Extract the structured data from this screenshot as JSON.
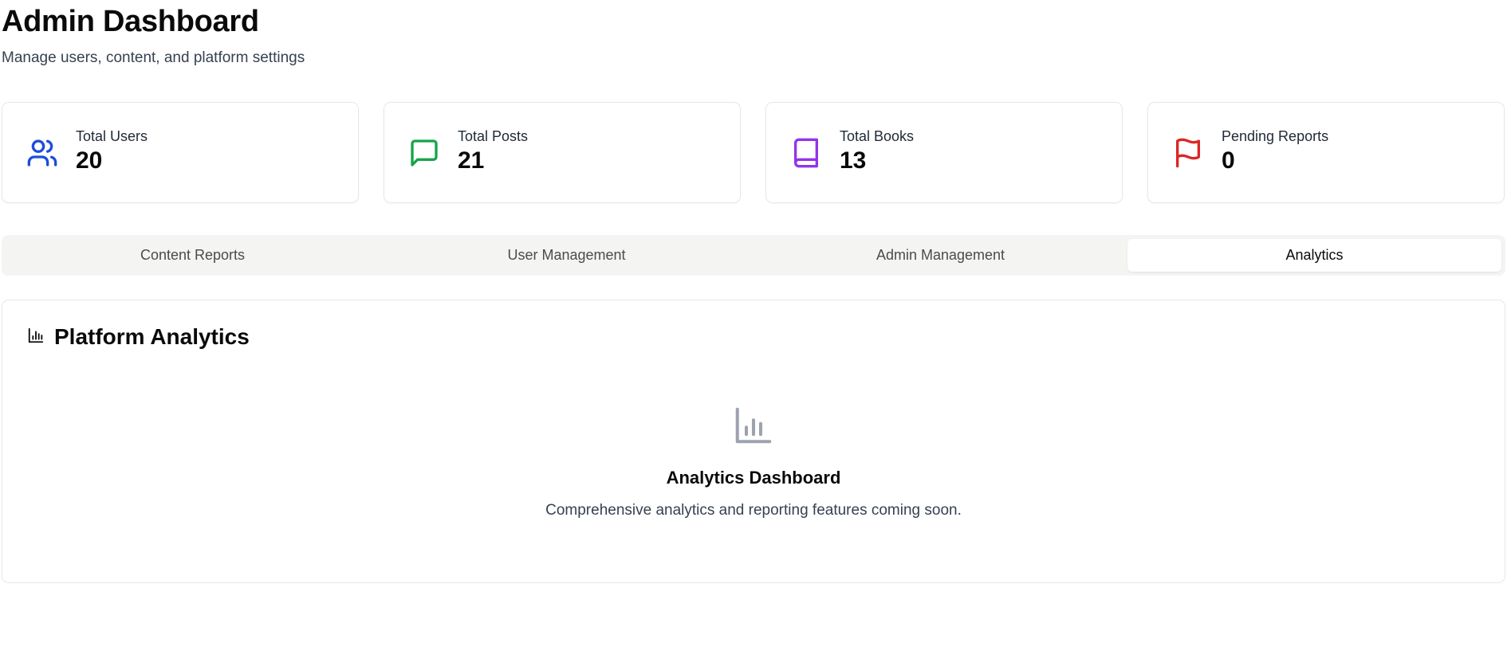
{
  "header": {
    "title": "Admin Dashboard",
    "subtitle": "Manage users, content, and platform settings"
  },
  "stats": [
    {
      "label": "Total Users",
      "value": "20",
      "icon": "users-icon",
      "color": "#1d4ed8"
    },
    {
      "label": "Total Posts",
      "value": "21",
      "icon": "message-square-icon",
      "color": "#16a34a"
    },
    {
      "label": "Total Books",
      "value": "13",
      "icon": "book-icon",
      "color": "#9333ea"
    },
    {
      "label": "Pending Reports",
      "value": "0",
      "icon": "flag-icon",
      "color": "#dc2626"
    }
  ],
  "tabs": [
    {
      "label": "Content Reports",
      "active": false
    },
    {
      "label": "User Management",
      "active": false
    },
    {
      "label": "Admin Management",
      "active": false
    },
    {
      "label": "Analytics",
      "active": true
    }
  ],
  "panel": {
    "title": "Platform Analytics",
    "title_icon": "bar-chart-icon",
    "empty_icon": "bar-chart-icon",
    "empty_icon_color": "#9ca3af",
    "empty_title": "Analytics Dashboard",
    "empty_description": "Comprehensive analytics and reporting features coming soon."
  }
}
